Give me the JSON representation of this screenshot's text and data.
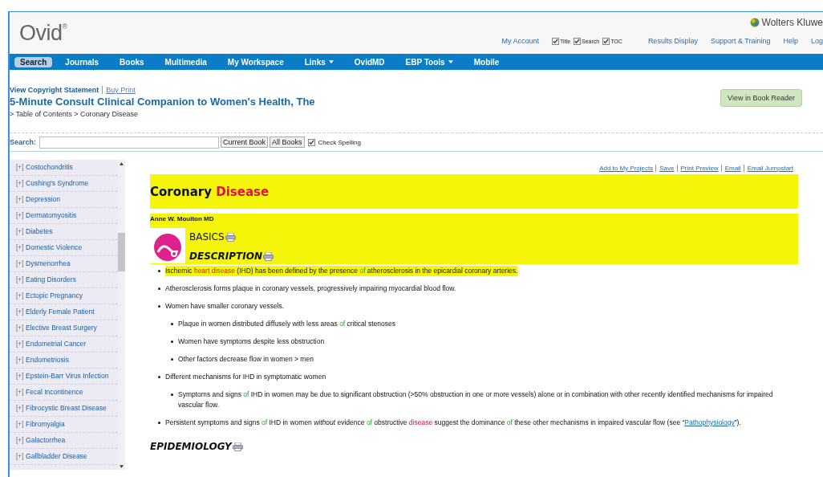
{
  "header": {
    "logo": "Ovid",
    "logo_mark": "®",
    "brand": "Wolters Kluwe",
    "account": "My Account",
    "options": [
      {
        "label": "Title",
        "checked": true
      },
      {
        "label": "Search",
        "checked": true
      },
      {
        "label": "TOC",
        "checked": true
      }
    ],
    "links": [
      "Results Display",
      "Support & Training",
      "Help",
      "Log"
    ]
  },
  "nav": [
    {
      "label": "Search",
      "selected": true,
      "dropdown": false
    },
    {
      "label": "Journals",
      "selected": false,
      "dropdown": false
    },
    {
      "label": "Books",
      "selected": false,
      "dropdown": false
    },
    {
      "label": "Multimedia",
      "selected": false,
      "dropdown": false
    },
    {
      "label": "My Workspace",
      "selected": false,
      "dropdown": false
    },
    {
      "label": "Links",
      "selected": false,
      "dropdown": true
    },
    {
      "label": "OvidMD",
      "selected": false,
      "dropdown": false
    },
    {
      "label": "EBP Tools",
      "selected": false,
      "dropdown": true
    },
    {
      "label": "Mobile",
      "selected": false,
      "dropdown": false
    }
  ],
  "book": {
    "copyright": "View Copyright Statement",
    "buy": "Buy Print",
    "title": "5-Minute Consult Clinical Companion to Women's Health, The",
    "breadcrumb": "> Table of Contents > Coronary Disease",
    "reader_button": "View in Book Reader"
  },
  "search": {
    "label": "Search:",
    "buttons": [
      "Current Book",
      "All Books"
    ],
    "spelling": {
      "label": "Check Spelling",
      "checked": true
    }
  },
  "sidebar": {
    "items": [
      {
        "toggle": "[+]",
        "label": "Costochondritis"
      },
      {
        "toggle": "[+]",
        "label": "Cushing's Syndrome"
      },
      {
        "toggle": "[+]",
        "label": "Depression"
      },
      {
        "toggle": "[+]",
        "label": "Dermatomyositis"
      },
      {
        "toggle": "[+]",
        "label": "Diabetes"
      },
      {
        "toggle": "[+]",
        "label": "Domestic Violence"
      },
      {
        "toggle": "[+]",
        "label": "Dysmenorrhea"
      },
      {
        "toggle": "[+]",
        "label": "Eating Disorders"
      },
      {
        "toggle": "[+]",
        "label": "Ectopic Pregnancy"
      },
      {
        "toggle": "[+]",
        "label": "Elderly Female Patient"
      },
      {
        "toggle": "[+]",
        "label": "Elective Breast Surgery"
      },
      {
        "toggle": "[+]",
        "label": "Endometrial Cancer"
      },
      {
        "toggle": "[+]",
        "label": "Endometriosis"
      },
      {
        "toggle": "[+]",
        "label": "Epstein-Barr Virus Infection"
      },
      {
        "toggle": "[+]",
        "label": "Fecal Incontinence"
      },
      {
        "toggle": "[+]",
        "label": "Fibrocystic Breast Disease"
      },
      {
        "toggle": "[+]",
        "label": "Fibromyalgia"
      },
      {
        "toggle": "[+]",
        "label": "Galactorrhea"
      },
      {
        "toggle": "[+]",
        "label": "Gallbladder Disease"
      }
    ]
  },
  "article": {
    "actions": [
      "Add to My Projects",
      "Save",
      "Print Preview",
      "Email",
      "Email Jumpstart"
    ],
    "title": [
      {
        "kind": "plain",
        "text": "Coronary "
      },
      {
        "kind": "term",
        "text": "Disease"
      }
    ],
    "author": "Anne W. Moulton MD",
    "sections": [
      "BASICS",
      "DESCRIPTION"
    ],
    "bullets": [
      {
        "highlighted": true,
        "segments": [
          {
            "kind": "plain",
            "text": "Ischemic "
          },
          {
            "kind": "term",
            "text": "heart disease"
          },
          {
            "kind": "plain",
            "text": " (IHD) has been defined by the presence "
          },
          {
            "kind": "stop",
            "text": "of"
          },
          {
            "kind": "plain",
            "text": " atherosclerosis in the epicardial coronary arteries."
          }
        ]
      },
      {
        "highlighted": false,
        "segments": [
          {
            "kind": "plain",
            "text": "Atherosclerosis forms plaque in coronary vessels, progressively impairing myocardial blood flow."
          }
        ]
      },
      {
        "highlighted": false,
        "segments": [
          {
            "kind": "plain",
            "text": "Women have smaller coronary vessels."
          }
        ],
        "children": [
          {
            "segments": [
              {
                "kind": "plain",
                "text": "Plaque in women distributed diffusely with less areas "
              },
              {
                "kind": "stop",
                "text": "of"
              },
              {
                "kind": "plain",
                "text": " critical stenoses"
              }
            ]
          },
          {
            "segments": [
              {
                "kind": "plain",
                "text": "Women have symptoms despite less obstruction"
              }
            ]
          },
          {
            "segments": [
              {
                "kind": "plain",
                "text": "Other factors decrease flow in women > men"
              }
            ]
          }
        ]
      },
      {
        "highlighted": false,
        "segments": [
          {
            "kind": "plain",
            "text": "Different mechanisms for IHD in symptomatic women"
          }
        ],
        "children": [
          {
            "segments": [
              {
                "kind": "plain",
                "text": "Symptoms and signs "
              },
              {
                "kind": "stop",
                "text": "of"
              },
              {
                "kind": "plain",
                "text": " IHD in women may be due to significant obstruction (>50% obstruction in one or more vessels) alone or in combination with other recently identified mechanisms for impaired vascular flow."
              }
            ]
          }
        ]
      },
      {
        "highlighted": false,
        "segments": [
          {
            "kind": "plain",
            "text": "Persistent symptoms and signs "
          },
          {
            "kind": "stop",
            "text": "of"
          },
          {
            "kind": "plain",
            "text": " IHD in women "
          },
          {
            "kind": "italic",
            "text": "without"
          },
          {
            "kind": "plain",
            "text": " evidence "
          },
          {
            "kind": "stop",
            "text": "of"
          },
          {
            "kind": "plain",
            "text": " obstructive "
          },
          {
            "kind": "term",
            "text": "disease"
          },
          {
            "kind": "plain",
            "text": " suggest the dominance "
          },
          {
            "kind": "stop",
            "text": "of"
          },
          {
            "kind": "plain",
            "text": " these other mechanisms in impaired vascular flow (see “"
          },
          {
            "kind": "link",
            "text": "Pathophysiology"
          },
          {
            "kind": "plain",
            "text": "”)."
          }
        ]
      }
    ],
    "next_section": "EPIDEMIOLOGY"
  }
}
